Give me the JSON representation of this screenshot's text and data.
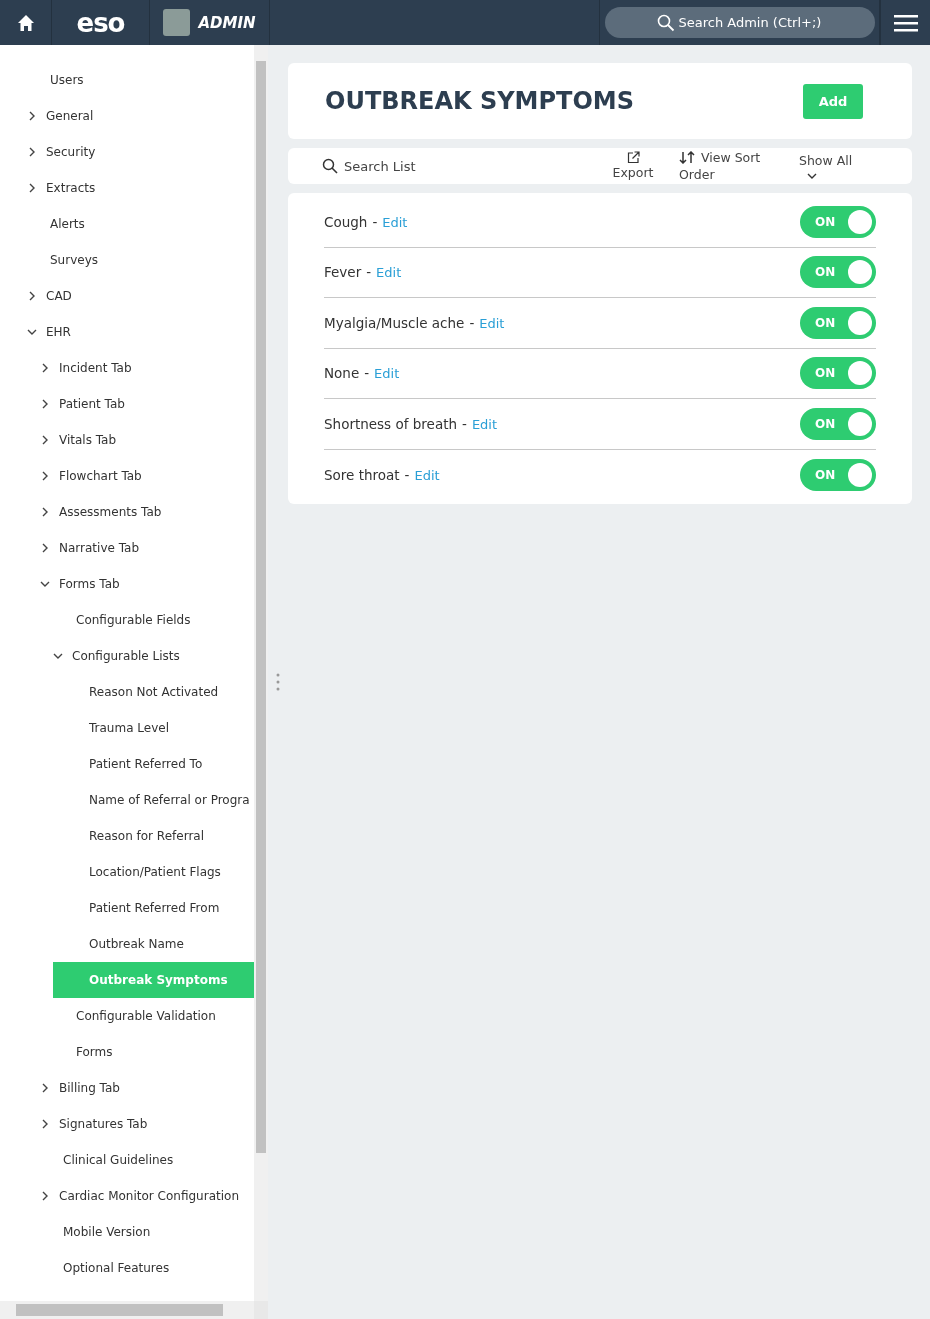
{
  "header": {
    "logo": "eso",
    "app_label": "ADMIN",
    "search": {
      "placeholder": "Search Admin (Ctrl+;)"
    }
  },
  "sidebar": {
    "items": [
      {
        "label": "Users",
        "selected": false
      },
      {
        "label": "General",
        "selected": false,
        "expanded": false
      },
      {
        "label": "Security",
        "selected": false,
        "expanded": false
      },
      {
        "label": "Extracts",
        "selected": false,
        "expanded": false
      },
      {
        "label": "Alerts",
        "selected": false
      },
      {
        "label": "Surveys",
        "selected": false
      },
      {
        "label": "CAD",
        "selected": false,
        "expanded": false
      },
      {
        "label": "EHR",
        "selected": false,
        "expanded": true,
        "children": [
          {
            "label": "Incident Tab",
            "selected": false,
            "expanded": false
          },
          {
            "label": "Patient Tab",
            "selected": false,
            "expanded": false
          },
          {
            "label": "Vitals Tab",
            "selected": false,
            "expanded": false
          },
          {
            "label": "Flowchart Tab",
            "selected": false,
            "expanded": false
          },
          {
            "label": "Assessments Tab",
            "selected": false,
            "expanded": false
          },
          {
            "label": "Narrative Tab",
            "selected": false,
            "expanded": false
          },
          {
            "label": "Forms Tab",
            "selected": false,
            "expanded": true,
            "children": [
              {
                "label": "Configurable Fields",
                "selected": false
              },
              {
                "label": "Configurable Lists",
                "selected": false,
                "expanded": true,
                "children": [
                  {
                    "label": "Reason Not Activated",
                    "selected": false
                  },
                  {
                    "label": "Trauma Level",
                    "selected": false
                  },
                  {
                    "label": "Patient Referred To",
                    "selected": false
                  },
                  {
                    "label": "Name of Referral or Progra",
                    "selected": false
                  },
                  {
                    "label": "Reason for Referral",
                    "selected": false
                  },
                  {
                    "label": "Location/Patient Flags",
                    "selected": false
                  },
                  {
                    "label": "Patient Referred From",
                    "selected": false
                  },
                  {
                    "label": "Outbreak Name",
                    "selected": false
                  },
                  {
                    "label": "Outbreak Symptoms",
                    "selected": true
                  }
                ]
              },
              {
                "label": "Configurable Validation",
                "selected": false
              },
              {
                "label": "Forms",
                "selected": false
              }
            ]
          },
          {
            "label": "Billing Tab",
            "selected": false,
            "expanded": false
          },
          {
            "label": "Signatures Tab",
            "selected": false,
            "expanded": false
          },
          {
            "label": "Clinical Guidelines",
            "selected": false
          },
          {
            "label": "Cardiac Monitor Configuration",
            "selected": false,
            "expanded": false
          },
          {
            "label": "Mobile Version",
            "selected": false
          },
          {
            "label": "Optional Features",
            "selected": false
          }
        ]
      }
    ]
  },
  "page": {
    "title": "OUTBREAK SYMPTOMS",
    "add_button": "Add"
  },
  "toolbar": {
    "search": {
      "placeholder": "Search List"
    },
    "export": "Export",
    "sort": "View Sort Order",
    "filter": "Show All"
  },
  "list": {
    "items": [
      {
        "name": "Cough",
        "separator": "-",
        "edit": "Edit",
        "on": true,
        "toggle_label": "ON"
      },
      {
        "name": "Fever",
        "separator": "-",
        "edit": "Edit",
        "on": true,
        "toggle_label": "ON"
      },
      {
        "name": "Myalgia/Muscle ache",
        "separator": "-",
        "edit": "Edit",
        "on": true,
        "toggle_label": "ON"
      },
      {
        "name": "None",
        "separator": "-",
        "edit": "Edit",
        "on": true,
        "toggle_label": "ON"
      },
      {
        "name": "Shortness of breath",
        "separator": "-",
        "edit": "Edit",
        "on": true,
        "toggle_label": "ON"
      },
      {
        "name": "Sore throat",
        "separator": "-",
        "edit": "Edit",
        "on": true,
        "toggle_label": "ON"
      }
    ]
  }
}
